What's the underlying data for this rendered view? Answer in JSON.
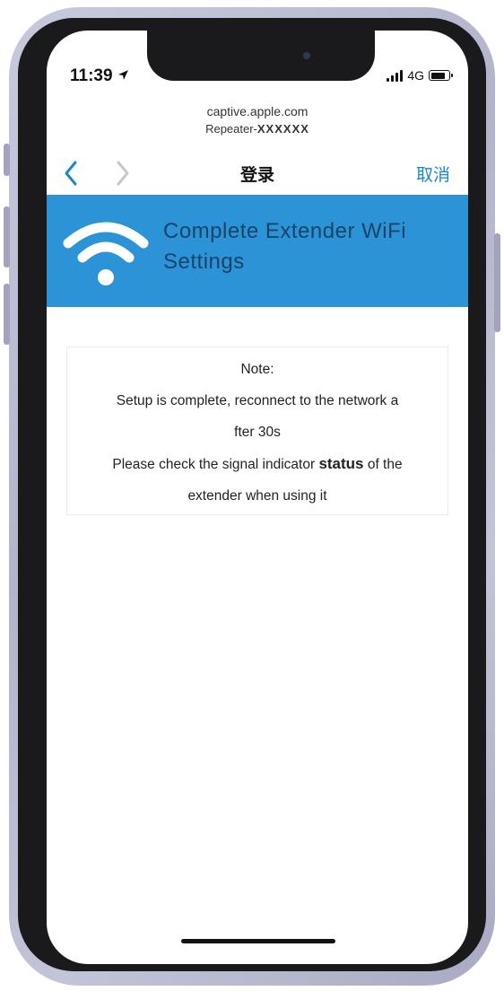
{
  "status_bar": {
    "time": "11:39",
    "location_icon": "location-arrow-icon",
    "network": "4G"
  },
  "captive": {
    "host": "captive.apple.com",
    "ssid_prefix": "Repeater-",
    "ssid_suffix": "XXXXXX"
  },
  "nav": {
    "back_icon": "chevron-left-icon",
    "forward_icon": "chevron-right-icon",
    "title": "登录",
    "cancel_label": "取消"
  },
  "banner": {
    "icon": "wifi-icon",
    "title": "Complete Extender WiFi Settings",
    "background": "#2c94d6",
    "title_color": "#18436a"
  },
  "note": {
    "heading": "Note:",
    "line1": "Setup is complete, reconnect to the network a",
    "line2": "fter 30s",
    "line3_prefix": "Please check the signal indicator ",
    "line3_bold": "status",
    "line3_suffix": " of the",
    "line4": "extender when using it"
  },
  "colors": {
    "accent": "#1e88c7",
    "disabled": "#c8c8cc"
  }
}
